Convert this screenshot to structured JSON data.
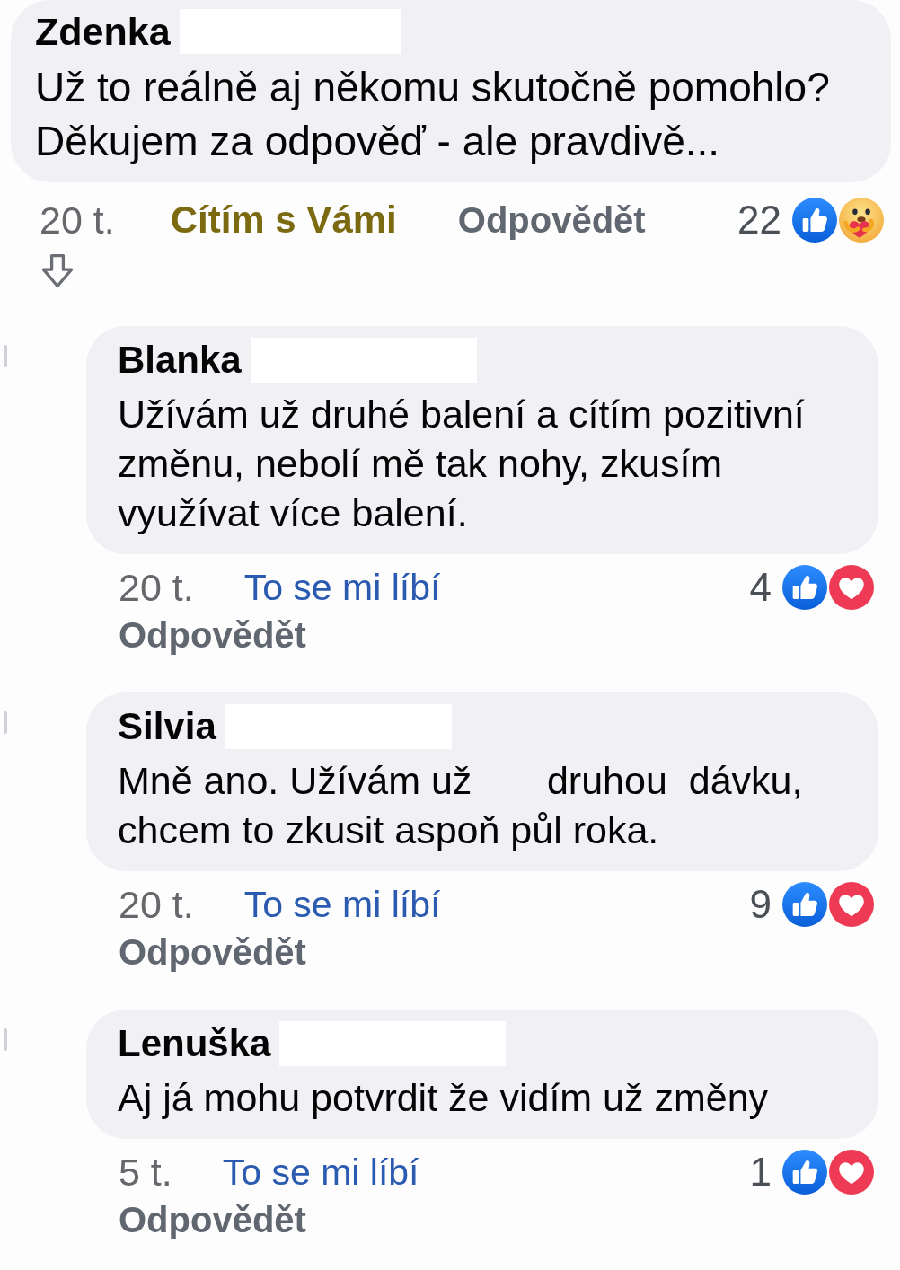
{
  "comment": {
    "author": "Zdenka",
    "surname_hidden": true,
    "text": "Už to reálně aj někomu skutočně pomohlo? Děkujem za odpověď - ale pravdivě...",
    "time": "20 t.",
    "reaction": {
      "label": "Cítím s Vámi",
      "kind": "care"
    },
    "reply_label": "Odpovědět",
    "reaction_count": "22",
    "reaction_icons": [
      {
        "kind": "like"
      },
      {
        "kind": "care"
      }
    ]
  },
  "replies": [
    {
      "author": "Blanka",
      "surname_hidden": true,
      "text": "Užívám už druhé balení a cítím pozitivní změnu, nebolí mě tak nohy, zkusím využívat více balení.",
      "time": "20 t.",
      "reaction": {
        "label": "To se mi líbí",
        "kind": "like"
      },
      "reply_label": "Odpovědět",
      "reaction_count": "4",
      "reaction_icons": [
        {
          "kind": "like"
        },
        {
          "kind": "love"
        }
      ]
    },
    {
      "author": "Silvia",
      "surname_hidden": true,
      "text": "Mně ano. Užívám už       druhou  dávku, chcem to zkusit aspoň půl roka.",
      "time": "20 t.",
      "reaction": {
        "label": "To se mi líbí",
        "kind": "like"
      },
      "reply_label": "Odpovědět",
      "reaction_count": "9",
      "reaction_icons": [
        {
          "kind": "like"
        },
        {
          "kind": "love"
        }
      ]
    },
    {
      "author": "Lenuška",
      "surname_hidden": true,
      "text": "Aj já mohu potvrdit že vidím už změny",
      "time": "5 t.",
      "reaction": {
        "label": "To se mi líbí",
        "kind": "like"
      },
      "reply_label": "Odpovědět",
      "reaction_count": "1",
      "reaction_icons": [
        {
          "kind": "like"
        },
        {
          "kind": "love"
        }
      ]
    }
  ]
}
